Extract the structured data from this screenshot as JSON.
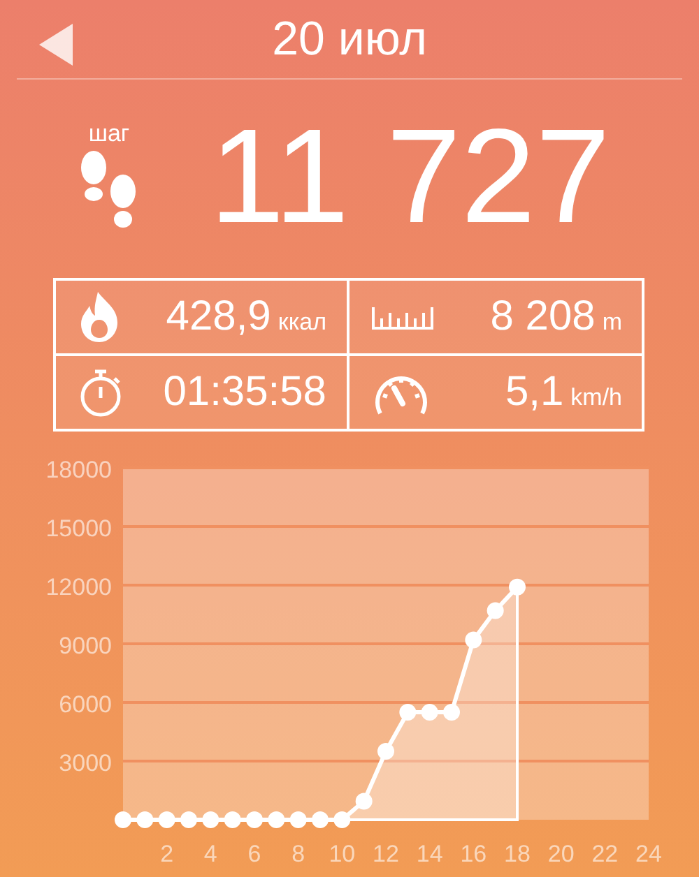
{
  "header": {
    "title": "20 июл"
  },
  "steps": {
    "label": "шаг",
    "value": "11 727"
  },
  "stats": [
    {
      "kind": "calories",
      "value": "428,9",
      "unit": "ккал"
    },
    {
      "kind": "distance",
      "value": "8 208",
      "unit": "m"
    },
    {
      "kind": "duration",
      "value": "01:35:58"
    },
    {
      "kind": "speed",
      "value": "5,1",
      "unit": "km/h"
    }
  ],
  "chart_data": {
    "type": "area",
    "x": [
      0,
      1,
      2,
      3,
      4,
      5,
      6,
      7,
      8,
      9,
      10,
      11,
      12,
      13,
      14,
      15,
      16,
      17,
      18
    ],
    "series": [
      {
        "color": "#ffffff",
        "values": [
          0,
          0,
          0,
          0,
          0,
          0,
          0,
          0,
          0,
          0,
          0,
          950,
          3500,
          5500,
          5500,
          5500,
          9200,
          10700,
          11900
        ]
      }
    ],
    "grid": true,
    "xlim": [
      0,
      24
    ],
    "ylim": [
      0,
      18000
    ],
    "xticks": [
      2,
      4,
      6,
      8,
      10,
      12,
      14,
      16,
      18,
      20,
      22,
      24
    ],
    "yticks": [
      3000,
      6000,
      9000,
      12000,
      15000,
      18000
    ]
  }
}
